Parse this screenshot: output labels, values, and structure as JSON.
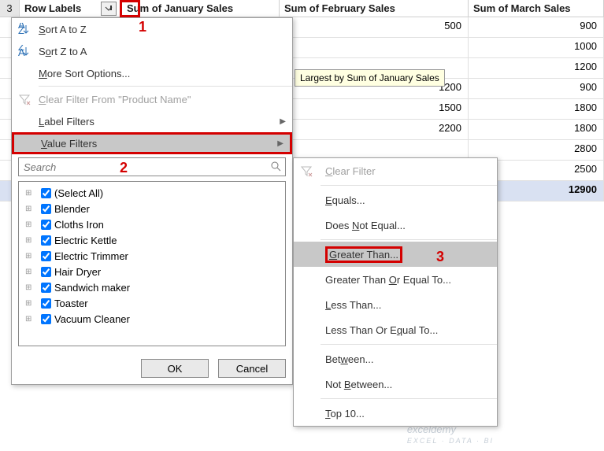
{
  "header": {
    "rownum": "3",
    "rowlabels": "Row Labels",
    "jan": "Sum of January Sales",
    "feb": "Sum of February Sales",
    "mar": "Sum of March Sales"
  },
  "grid": {
    "rows": [
      {
        "feb": "500",
        "mar": "900"
      },
      {
        "feb": "",
        "mar": "1000"
      },
      {
        "feb": "",
        "mar": "1200"
      },
      {
        "feb": "1200",
        "mar": "900"
      },
      {
        "feb": "1500",
        "mar": "1800"
      },
      {
        "feb": "2200",
        "mar": "1800"
      },
      {
        "feb": "",
        "mar": "2800"
      },
      {
        "feb": "",
        "mar": "2500"
      },
      {
        "feb": "",
        "mar": "12900",
        "grand": true
      }
    ]
  },
  "tooltip": "Largest by Sum of January Sales",
  "menu": {
    "sort_asc": "Sort A to Z",
    "sort_desc": "Sort Z to A",
    "more_sort": "More Sort Options...",
    "clear_filter": "Clear Filter From \"Product Name\"",
    "label_filters": "Label Filters",
    "value_filters": "Value Filters",
    "search_placeholder": "Search",
    "ok": "OK",
    "cancel": "Cancel",
    "items": [
      "(Select All)",
      "Blender",
      "Cloths Iron",
      "Electric Kettle",
      "Electric Trimmer",
      "Hair Dryer",
      "Sandwich maker",
      "Toaster",
      "Vacuum Cleaner"
    ]
  },
  "submenu": {
    "clear": "Clear Filter",
    "equals": "Equals...",
    "not_equal": "Does Not Equal...",
    "greater": "Greater Than...",
    "greater_eq": "Greater Than Or Equal To...",
    "less": "Less Than...",
    "less_eq": "Less Than Or Equal To...",
    "between": "Between...",
    "not_between": "Not Between...",
    "top10": "Top 10..."
  },
  "annotations": {
    "a1": "1",
    "a2": "2",
    "a3": "3"
  },
  "watermark": {
    "main": "exceldemy",
    "sub": "EXCEL · DATA · BI"
  }
}
